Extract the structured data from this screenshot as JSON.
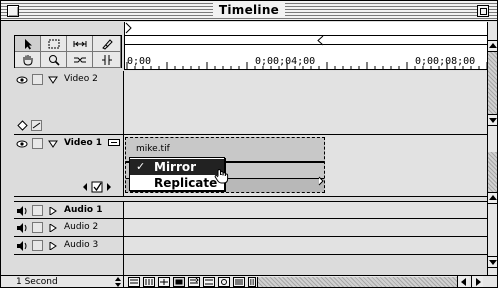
{
  "window": {
    "title": "Timeline"
  },
  "ruler": {
    "labels": [
      "0;00",
      "0;00;04;00",
      "0;00;08;00"
    ]
  },
  "tracks": [
    {
      "name": "Video 2",
      "bold": false,
      "type": "video"
    },
    {
      "name": "Video 1",
      "bold": true,
      "type": "video"
    },
    {
      "name": "Audio 1",
      "bold": true,
      "type": "audio"
    },
    {
      "name": "Audio 2",
      "bold": false,
      "type": "audio"
    },
    {
      "name": "Audio 3",
      "bold": false,
      "type": "audio"
    }
  ],
  "clip": {
    "filename": "mike.tif"
  },
  "context_menu": {
    "items": [
      {
        "label": "Mirror",
        "checked": true,
        "highlighted": true
      },
      {
        "label": "Replicate",
        "checked": false,
        "highlighted": false
      }
    ],
    "check_glyph": "✓"
  },
  "bottom_bar": {
    "time_unit": "1 Second"
  },
  "icons": {
    "tools": [
      "arrow-select-icon",
      "marquee-select-icon",
      "track-select-icon",
      "razor-icon",
      "hand-icon",
      "zoom-icon",
      "link-icon",
      "in-out-icon"
    ]
  },
  "colors": {
    "chrome": "#dcdcdc",
    "highlight_bg": "#222222",
    "highlight_fg": "#ffffff"
  }
}
